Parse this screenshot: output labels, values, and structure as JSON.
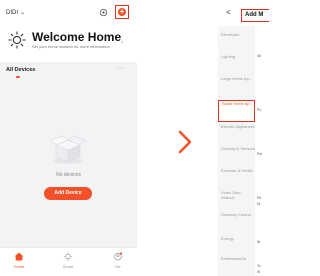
{
  "left_screen": {
    "home_name": "DIDI",
    "home_chevron": "⌄",
    "header_icons": {
      "scan": "scan-icon",
      "add": "plus-circle-icon"
    },
    "add_symbol": "+",
    "welcome": {
      "title": "Welcome Home",
      "subtitle": "Set your home location for more information",
      "arrow": "›"
    },
    "tab_label": "All Devices",
    "more": "···",
    "empty_state": {
      "text": "No devices",
      "button": "Add Device"
    },
    "bottom_nav": [
      {
        "label": "Home",
        "icon": "home-icon",
        "active": true
      },
      {
        "label": "Smart",
        "icon": "smart-icon",
        "active": false
      },
      {
        "label": "Me",
        "icon": "profile-icon",
        "active": false
      }
    ]
  },
  "right_screen": {
    "back": "<",
    "title": "Add M",
    "categories": [
      {
        "label": "Electrician",
        "active": false
      },
      {
        "label": "Lighting",
        "active": false
      },
      {
        "label": "Large Home Ap...",
        "active": false
      },
      {
        "label": "Small Home Ap...",
        "active": true
      },
      {
        "label": "Kitchen Appliances",
        "active": false
      },
      {
        "label": "Security & Sensors",
        "active": false
      },
      {
        "label": "Exercise & Health",
        "active": false
      },
      {
        "label": "Video Surv-eillance",
        "active": false
      },
      {
        "label": "Gateway Control",
        "active": false
      },
      {
        "label": "Energy",
        "active": false
      },
      {
        "label": "Entertainment",
        "active": false
      }
    ],
    "content_fragments": [
      "Sh",
      "Po",
      "Per",
      "Pe",
      "Di",
      "W",
      "Tc",
      "W"
    ]
  },
  "colors": {
    "accent": "#f4512a",
    "highlight_border": "#e0301e"
  }
}
